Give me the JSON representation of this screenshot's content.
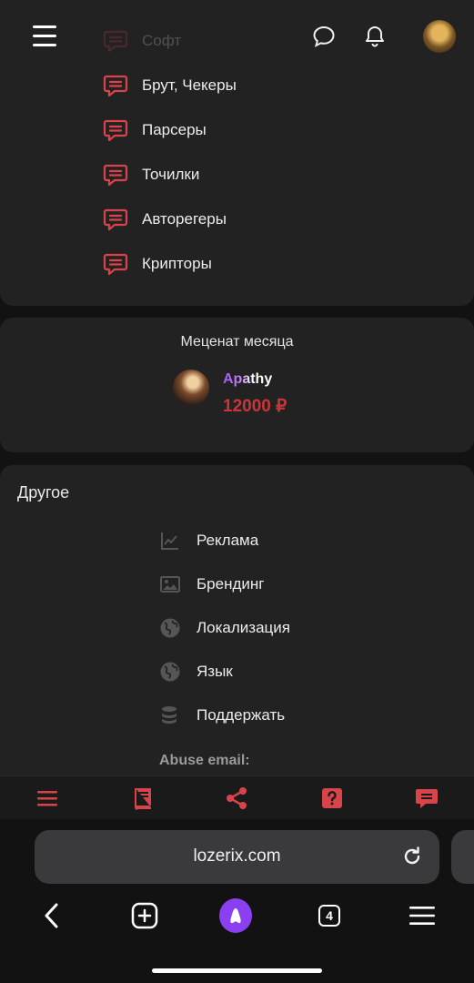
{
  "header": {
    "icons": [
      "menu-icon",
      "chat-icon",
      "bell-icon",
      "user-avatar"
    ]
  },
  "forums": {
    "items": [
      {
        "label": "Софт",
        "faded": true
      },
      {
        "label": "Брут, Чекеры"
      },
      {
        "label": "Парсеры"
      },
      {
        "label": "Точилки"
      },
      {
        "label": "Авторегеры"
      },
      {
        "label": "Крипторы"
      }
    ],
    "icon": "comment-icon",
    "icon_color": "#d9434a"
  },
  "patron": {
    "title": "Меценат месяца",
    "name": "Apathy",
    "amount": "12000 ₽"
  },
  "other": {
    "title": "Другое",
    "items": [
      {
        "label": "Реклама",
        "icon": "chart-icon"
      },
      {
        "label": "Брендинг",
        "icon": "image-icon"
      },
      {
        "label": "Локализация",
        "icon": "globe-icon"
      },
      {
        "label": "Язык",
        "icon": "globe-icon"
      },
      {
        "label": "Поддержать",
        "icon": "coins-icon"
      }
    ],
    "abuse_label": "Abuse email:"
  },
  "site_nav": {
    "icons": [
      "menu-icon",
      "book-icon",
      "share-icon",
      "help-icon",
      "comment-icon"
    ],
    "color": "#d9434a"
  },
  "browser": {
    "url": "lozerix.com",
    "tab_count": "4",
    "icons": [
      "back-icon",
      "new-tab-icon",
      "alice-icon",
      "tabs-icon",
      "menu-icon"
    ]
  },
  "colors": {
    "background": "#121212",
    "card": "#222222",
    "accent_red": "#d9434a",
    "amount_red": "#c8363a",
    "patron_purple": "#9b5cf0"
  }
}
